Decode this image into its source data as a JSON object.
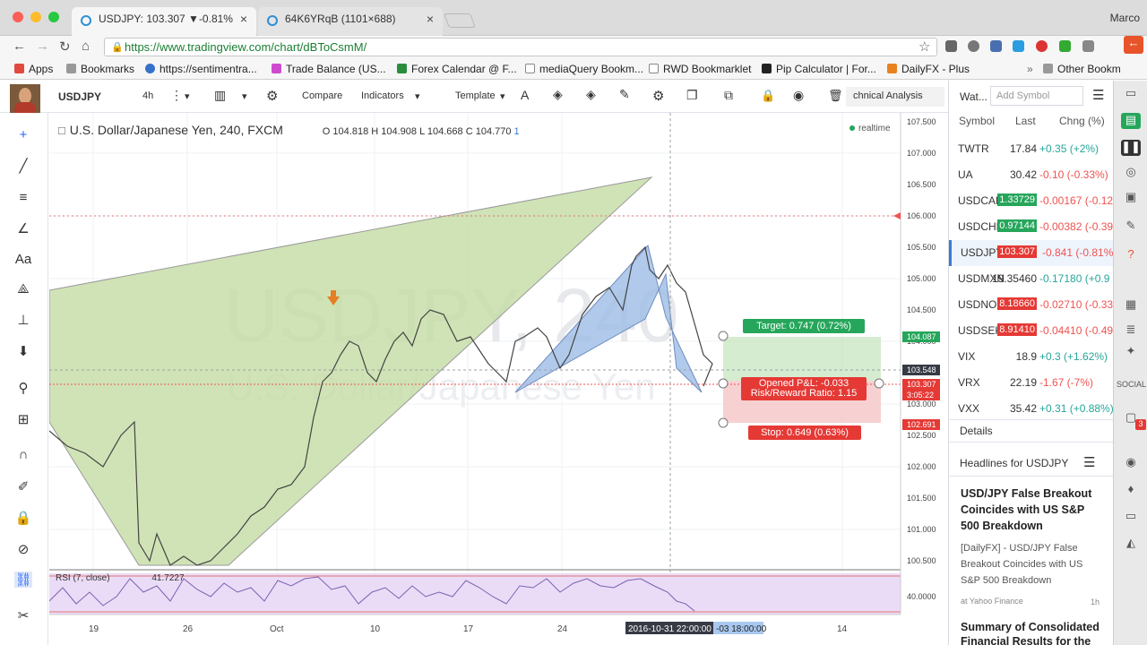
{
  "browser": {
    "tabs": [
      {
        "title": "USDJPY: 103.307 ▼-0.81%"
      },
      {
        "title": "64K6YRqB (1101×688)"
      }
    ],
    "user": "Marco",
    "url": "https://www.tradingview.com/chart/dBToCsmM/",
    "bookmarks": [
      "Apps",
      "Bookmarks",
      "https://sentimentra...",
      "Trade Balance (US...",
      "Forex Calendar @ F...",
      "mediaQuery Bookm...",
      "RWD Bookmarklet",
      "Pip Calculator | For...",
      "DailyFX - Plus",
      "Other Bookm"
    ]
  },
  "toolbar": {
    "symbol": "USDJPY",
    "interval": "4h",
    "compare": "Compare",
    "indicators": "Indicators",
    "template": "Template",
    "tech": "chnical Analysis"
  },
  "chart": {
    "title": "U.S. Dollar/Japanese Yen, 240, FXCM",
    "ohlc": {
      "o_label": "O",
      "o": "104.818",
      "h_label": "H",
      "h": "104.908",
      "l_label": "L",
      "l": "104.668",
      "c_label": "C",
      "c": "104.770",
      "count": "1"
    },
    "realtime": "realtime",
    "watermark_symbol": "USDJPY, 240",
    "watermark_name": "U.S. Dollar/Japanese Yen",
    "price_axis": [
      "107.500",
      "107.000",
      "106.500",
      "106.000",
      "105.500",
      "105.000",
      "104.500",
      "104.000",
      "103.500",
      "103.000",
      "102.500",
      "102.000",
      "101.500",
      "101.000",
      "100.500"
    ],
    "price_tags": {
      "target": "104.087",
      "cursor": "103.548",
      "last": "103.307",
      "countdown": "3:05:22",
      "stop": "102.691"
    },
    "time_axis": [
      "19",
      "26",
      "Oct",
      "10",
      "17",
      "24",
      "14"
    ],
    "time_cursor": "2016-10-31 22:00:00",
    "time_range": "-03 18:00:00",
    "position": {
      "target": "Target: 0.747 (0.72%)",
      "pnl": "Opened P&L: -0.033",
      "rr": "Risk/Reward Ratio: 1.15",
      "stop": "Stop: 0.649 (0.63%)"
    },
    "rsi": {
      "label": "RSI (7, close)",
      "value": "41.7227",
      "axis": [
        "40.0000"
      ]
    }
  },
  "watchlist": {
    "header": "Wat...",
    "add": "Add Symbol",
    "cols": [
      "Symbol",
      "Last",
      "Chng (%)"
    ],
    "rows": [
      {
        "sym": "TWTR",
        "last": "17.84",
        "chg": "+0.35 (+2%)",
        "color": "#26a69a",
        "pill": ""
      },
      {
        "sym": "UA",
        "last": "30.42",
        "chg": "-0.10 (-0.33%)",
        "color": "#ef5350",
        "pill": ""
      },
      {
        "sym": "USDCAD",
        "last": "1.33729",
        "chg": "-0.00167 (-0.12",
        "color": "#ef5350",
        "pill": "#26a65b"
      },
      {
        "sym": "USDCHF",
        "last": "0.97144",
        "chg": "-0.00382 (-0.39",
        "color": "#ef5350",
        "pill": "#26a65b"
      },
      {
        "sym": "USDJPY",
        "last": "103.307",
        "chg": "-0.841 (-0.81%)",
        "color": "#ef5350",
        "pill": "#e53935"
      },
      {
        "sym": "USDMXN",
        "last": "19.35460",
        "chg": "-0.17180 (+0.9",
        "color": "#26a69a",
        "pill": ""
      },
      {
        "sym": "USDNOK",
        "last": "8.18660",
        "chg": "-0.02710 (-0.33",
        "color": "#ef5350",
        "pill": "#e53935"
      },
      {
        "sym": "USDSEK",
        "last": "8.91410",
        "chg": "-0.04410 (-0.49",
        "color": "#ef5350",
        "pill": "#e53935"
      },
      {
        "sym": "VIX",
        "last": "18.9",
        "chg": "+0.3 (+1.62%)",
        "color": "#26a69a",
        "pill": ""
      },
      {
        "sym": "VRX",
        "last": "22.19",
        "chg": "-1.67 (-7%)",
        "color": "#ef5350",
        "pill": ""
      },
      {
        "sym": "VXX",
        "last": "35.42",
        "chg": "+0.31 (+0.88%)",
        "color": "#26a69a",
        "pill": ""
      }
    ],
    "details": "Details",
    "headlines": "Headlines for USDJPY",
    "news": [
      {
        "title": "USD/JPY False Breakout Coincides with US S&P 500 Breakdown",
        "body": "[DailyFX] - USD/JPY False Breakout Coincides with US S&P 500 Breakdown",
        "source": "at Yahoo Finance",
        "age": "1h"
      },
      {
        "title": "Summary of Consolidated Financial Results for the"
      }
    ]
  },
  "sidebar": {
    "social": "SOCIAL",
    "badge": "3"
  }
}
